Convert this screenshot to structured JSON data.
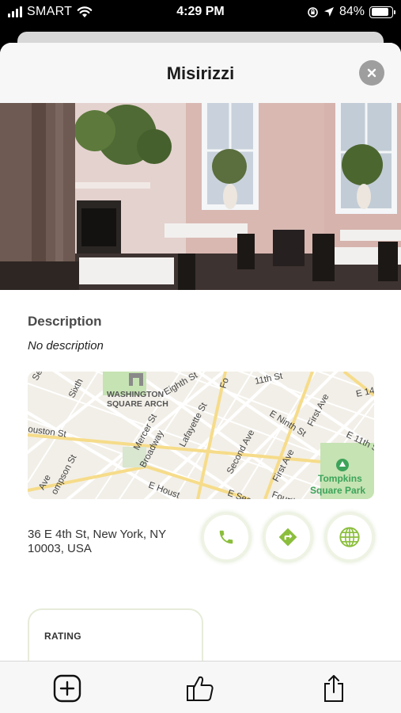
{
  "status_bar": {
    "carrier": "SMART",
    "time": "4:29 PM",
    "battery": "84%",
    "battery_level": 0.84
  },
  "sheet": {
    "title": "Misirizzi",
    "close_icon": "close-icon"
  },
  "description": {
    "label": "Description",
    "text": "No description"
  },
  "map": {
    "labels": {
      "arch": "WASHINGTON",
      "arch2": "SQUARE ARCH",
      "eighth": "Eighth St",
      "eleventh": "11th St",
      "e14": "E 14",
      "first_ave": "First Ave",
      "ninth": "E Ninth St",
      "lafayette": "Lafayette St",
      "mercer": "Mercer St",
      "second_ave": "Second Ave",
      "first_ave2": "First Ave",
      "houston": "ouston St",
      "broadway": "Broadway",
      "e_houston": "E Houst",
      "sixth": "Sixth",
      "park": "Tompkins",
      "park2": "Square Park",
      "e11th": "E 11th St",
      "thompson": "ompson St",
      "ave": "Ave",
      "fourth": "Fourth",
      "e_sec": "E Seco",
      "se": "Se",
      "fo": "Fo"
    }
  },
  "contact": {
    "address": "36 E 4th St, New York, NY 10003, USA",
    "phone_icon": "phone-icon",
    "directions_icon": "directions-icon",
    "website_icon": "globe-icon"
  },
  "rating": {
    "label": "RATING"
  },
  "tab_bar": {
    "add_icon": "add-square-icon",
    "like_icon": "thumbs-up-icon",
    "share_icon": "share-icon"
  },
  "colors": {
    "accent_green": "#8bbe3c",
    "button_border": "#eef3e4",
    "park_green": "#3ca35a"
  }
}
